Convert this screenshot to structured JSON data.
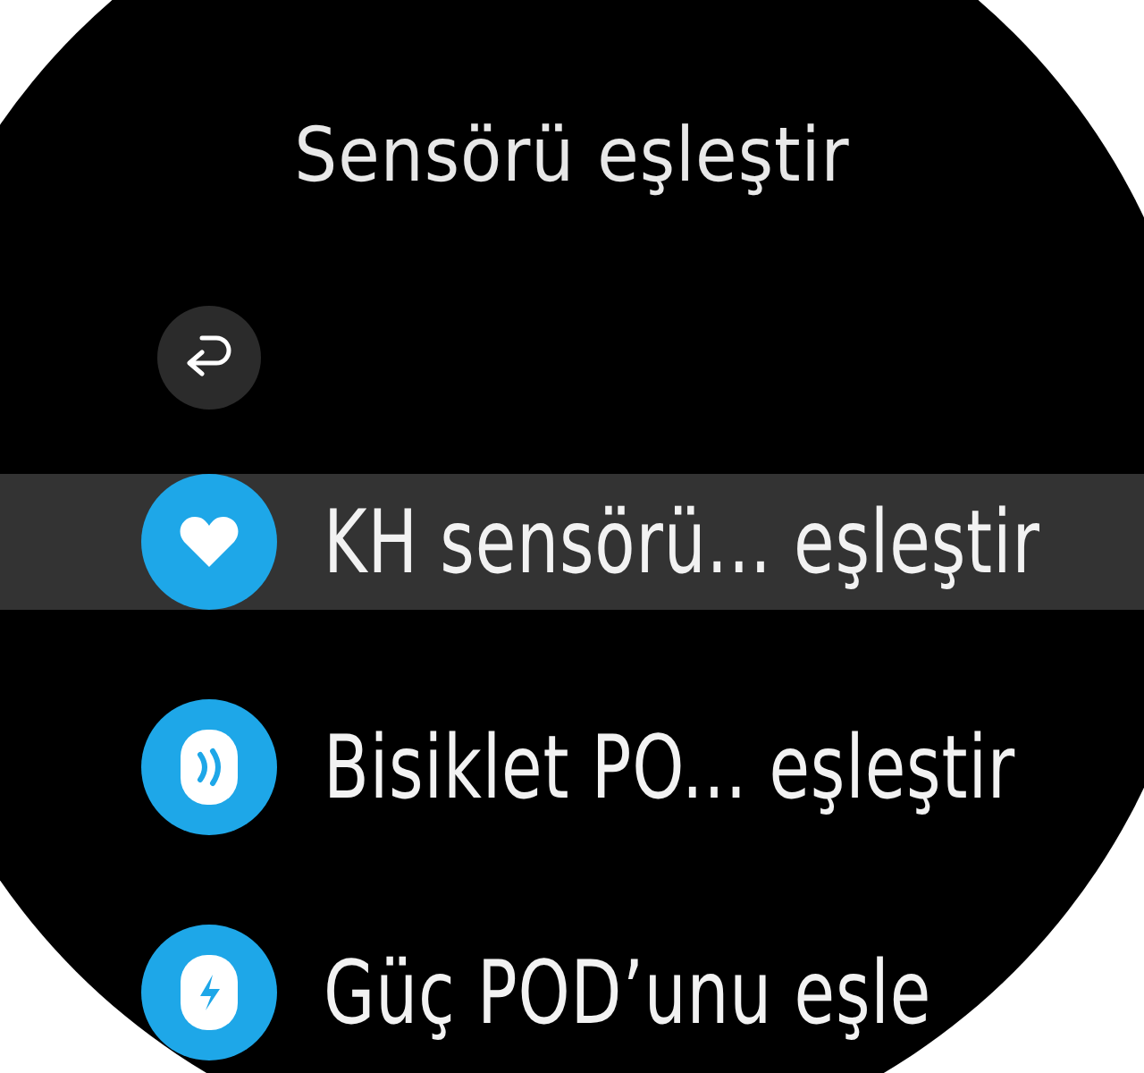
{
  "title": "Sensörü eşleştir",
  "back": {
    "kind": "back"
  },
  "items": [
    {
      "label": "KH sensörü... eşleştir",
      "kind": "heart",
      "selected": true
    },
    {
      "label": "Bisiklet PO... eşleştir",
      "kind": "pod",
      "selected": false
    },
    {
      "label": "Güç POD’unu eşle",
      "kind": "power",
      "selected": false
    }
  ]
}
